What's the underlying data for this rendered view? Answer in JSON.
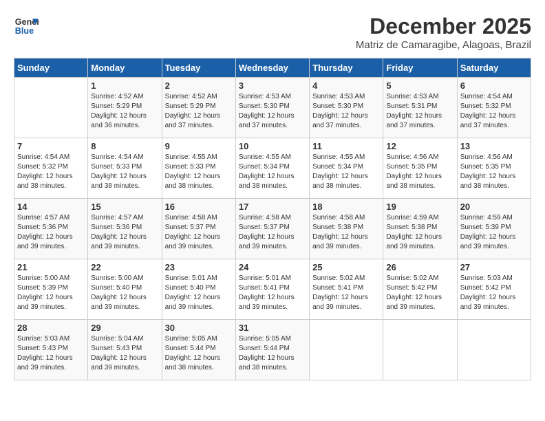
{
  "header": {
    "logo_line1": "General",
    "logo_line2": "Blue",
    "month_year": "December 2025",
    "location": "Matriz de Camaragibe, Alagoas, Brazil"
  },
  "days_of_week": [
    "Sunday",
    "Monday",
    "Tuesday",
    "Wednesday",
    "Thursday",
    "Friday",
    "Saturday"
  ],
  "weeks": [
    [
      {
        "day": "",
        "info": ""
      },
      {
        "day": "1",
        "info": "Sunrise: 4:52 AM\nSunset: 5:29 PM\nDaylight: 12 hours\nand 36 minutes."
      },
      {
        "day": "2",
        "info": "Sunrise: 4:52 AM\nSunset: 5:29 PM\nDaylight: 12 hours\nand 37 minutes."
      },
      {
        "day": "3",
        "info": "Sunrise: 4:53 AM\nSunset: 5:30 PM\nDaylight: 12 hours\nand 37 minutes."
      },
      {
        "day": "4",
        "info": "Sunrise: 4:53 AM\nSunset: 5:30 PM\nDaylight: 12 hours\nand 37 minutes."
      },
      {
        "day": "5",
        "info": "Sunrise: 4:53 AM\nSunset: 5:31 PM\nDaylight: 12 hours\nand 37 minutes."
      },
      {
        "day": "6",
        "info": "Sunrise: 4:54 AM\nSunset: 5:32 PM\nDaylight: 12 hours\nand 37 minutes."
      }
    ],
    [
      {
        "day": "7",
        "info": "Sunrise: 4:54 AM\nSunset: 5:32 PM\nDaylight: 12 hours\nand 38 minutes."
      },
      {
        "day": "8",
        "info": "Sunrise: 4:54 AM\nSunset: 5:33 PM\nDaylight: 12 hours\nand 38 minutes."
      },
      {
        "day": "9",
        "info": "Sunrise: 4:55 AM\nSunset: 5:33 PM\nDaylight: 12 hours\nand 38 minutes."
      },
      {
        "day": "10",
        "info": "Sunrise: 4:55 AM\nSunset: 5:34 PM\nDaylight: 12 hours\nand 38 minutes."
      },
      {
        "day": "11",
        "info": "Sunrise: 4:55 AM\nSunset: 5:34 PM\nDaylight: 12 hours\nand 38 minutes."
      },
      {
        "day": "12",
        "info": "Sunrise: 4:56 AM\nSunset: 5:35 PM\nDaylight: 12 hours\nand 38 minutes."
      },
      {
        "day": "13",
        "info": "Sunrise: 4:56 AM\nSunset: 5:35 PM\nDaylight: 12 hours\nand 38 minutes."
      }
    ],
    [
      {
        "day": "14",
        "info": "Sunrise: 4:57 AM\nSunset: 5:36 PM\nDaylight: 12 hours\nand 39 minutes."
      },
      {
        "day": "15",
        "info": "Sunrise: 4:57 AM\nSunset: 5:36 PM\nDaylight: 12 hours\nand 39 minutes."
      },
      {
        "day": "16",
        "info": "Sunrise: 4:58 AM\nSunset: 5:37 PM\nDaylight: 12 hours\nand 39 minutes."
      },
      {
        "day": "17",
        "info": "Sunrise: 4:58 AM\nSunset: 5:37 PM\nDaylight: 12 hours\nand 39 minutes."
      },
      {
        "day": "18",
        "info": "Sunrise: 4:58 AM\nSunset: 5:38 PM\nDaylight: 12 hours\nand 39 minutes."
      },
      {
        "day": "19",
        "info": "Sunrise: 4:59 AM\nSunset: 5:38 PM\nDaylight: 12 hours\nand 39 minutes."
      },
      {
        "day": "20",
        "info": "Sunrise: 4:59 AM\nSunset: 5:39 PM\nDaylight: 12 hours\nand 39 minutes."
      }
    ],
    [
      {
        "day": "21",
        "info": "Sunrise: 5:00 AM\nSunset: 5:39 PM\nDaylight: 12 hours\nand 39 minutes."
      },
      {
        "day": "22",
        "info": "Sunrise: 5:00 AM\nSunset: 5:40 PM\nDaylight: 12 hours\nand 39 minutes."
      },
      {
        "day": "23",
        "info": "Sunrise: 5:01 AM\nSunset: 5:40 PM\nDaylight: 12 hours\nand 39 minutes."
      },
      {
        "day": "24",
        "info": "Sunrise: 5:01 AM\nSunset: 5:41 PM\nDaylight: 12 hours\nand 39 minutes."
      },
      {
        "day": "25",
        "info": "Sunrise: 5:02 AM\nSunset: 5:41 PM\nDaylight: 12 hours\nand 39 minutes."
      },
      {
        "day": "26",
        "info": "Sunrise: 5:02 AM\nSunset: 5:42 PM\nDaylight: 12 hours\nand 39 minutes."
      },
      {
        "day": "27",
        "info": "Sunrise: 5:03 AM\nSunset: 5:42 PM\nDaylight: 12 hours\nand 39 minutes."
      }
    ],
    [
      {
        "day": "28",
        "info": "Sunrise: 5:03 AM\nSunset: 5:43 PM\nDaylight: 12 hours\nand 39 minutes."
      },
      {
        "day": "29",
        "info": "Sunrise: 5:04 AM\nSunset: 5:43 PM\nDaylight: 12 hours\nand 39 minutes."
      },
      {
        "day": "30",
        "info": "Sunrise: 5:05 AM\nSunset: 5:44 PM\nDaylight: 12 hours\nand 38 minutes."
      },
      {
        "day": "31",
        "info": "Sunrise: 5:05 AM\nSunset: 5:44 PM\nDaylight: 12 hours\nand 38 minutes."
      },
      {
        "day": "",
        "info": ""
      },
      {
        "day": "",
        "info": ""
      },
      {
        "day": "",
        "info": ""
      }
    ]
  ]
}
